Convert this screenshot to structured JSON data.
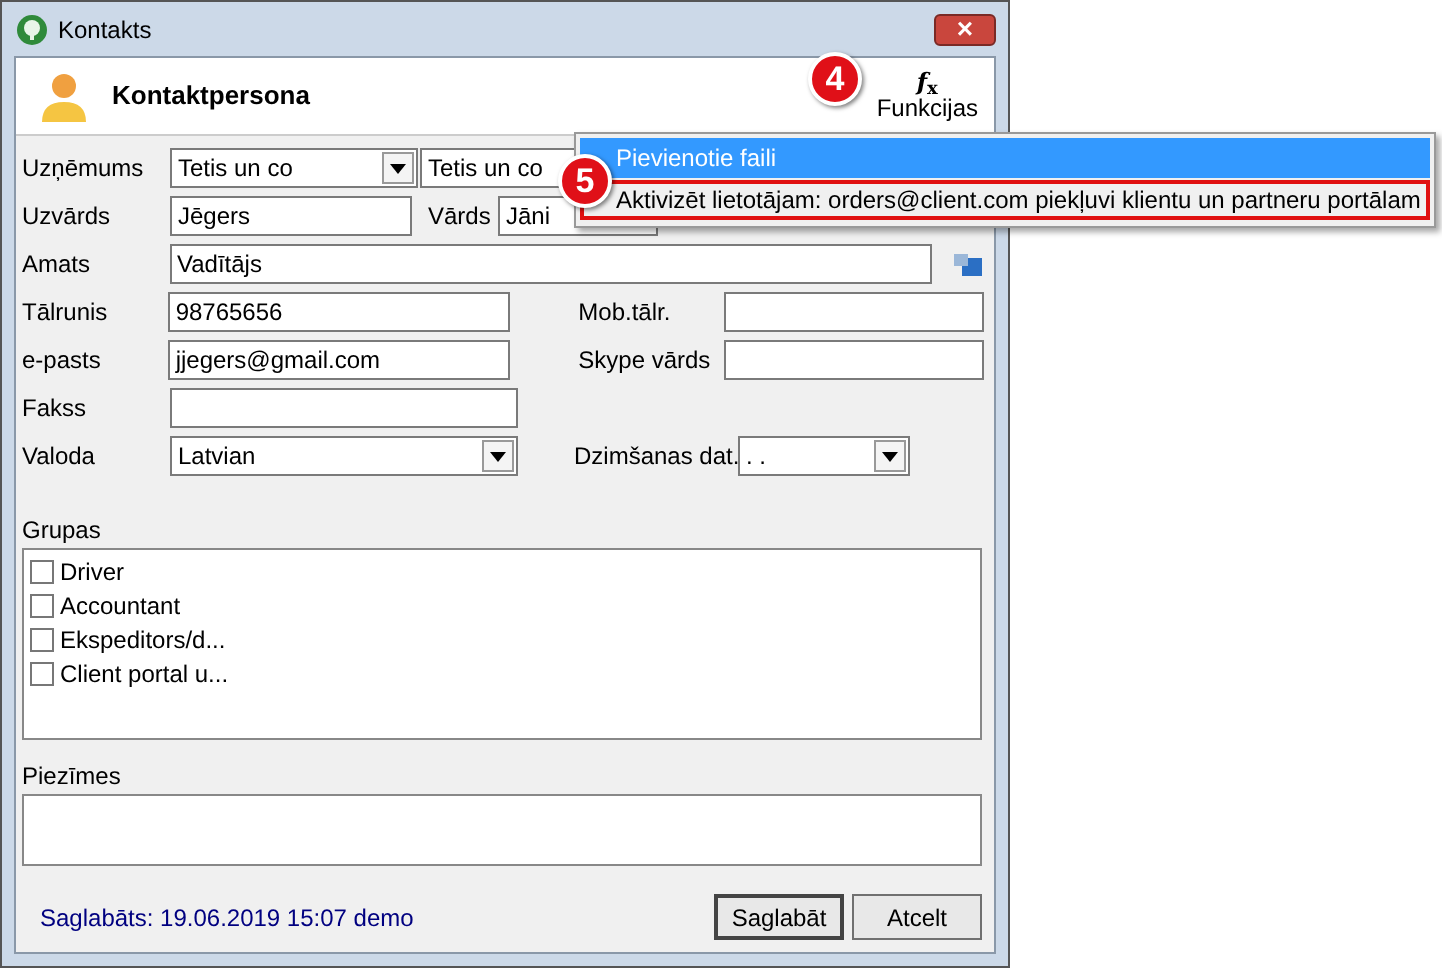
{
  "window": {
    "title": "Kontakts",
    "close": "×"
  },
  "header": {
    "title": "Kontaktpersona",
    "functions_button": {
      "icon": "*f*$_{x}$",
      "label": "Funkcijas"
    }
  },
  "callouts": [
    {
      "number": "4"
    },
    {
      "number": "5"
    }
  ],
  "form": {
    "company": {
      "label": "Uzņēmums",
      "value": "Tetis un co",
      "value_2": "Tetis un co"
    },
    "surname": {
      "label": "Uzvārds",
      "value": "Jēgers"
    },
    "name": {
      "label": "Vārds",
      "value": "Jāni"
    },
    "position": {
      "label": "Amats",
      "value": "Vadītājs"
    },
    "phone": {
      "label": "Tālrunis",
      "value": "98765656"
    },
    "mobile": {
      "label": "Mob.tālr."
    },
    "email": {
      "label": "e-pasts",
      "value": "jjegers@gmail.com"
    },
    "skype": {
      "label": "Skype vārds"
    },
    "fax": {
      "label": "Fakss"
    },
    "language": {
      "label": "Valoda",
      "value": "Latvian"
    },
    "birth_date": {
      "label": "Dzimšanas dat.",
      "value": ". ."
    }
  },
  "groups": {
    "label": "Grupas",
    "items": [
      {
        "label": "Driver",
        "checked": false
      },
      {
        "label": "Accountant",
        "checked": false
      },
      {
        "label": "Ekspeditors/d...",
        "checked": false
      },
      {
        "label": "Client portal u...",
        "checked": false
      }
    ]
  },
  "notes": {
    "label": "Piezīmes"
  },
  "status": "Saglabāts: 19.06.2019 15:07 demo",
  "buttons": [
    {
      "label": "Saglabāt",
      "default": true
    },
    {
      "label": "Atcelt",
      "default": false
    }
  ],
  "menu": {
    "items": [
      {
        "label": "Pievienotie faili",
        "selected": true,
        "outlined": false
      },
      {
        "label": "Aktivizēt lietotājam: orders@client.com piekļuvi klientu un partneru portālam",
        "selected": false,
        "outlined": true
      }
    ]
  }
}
